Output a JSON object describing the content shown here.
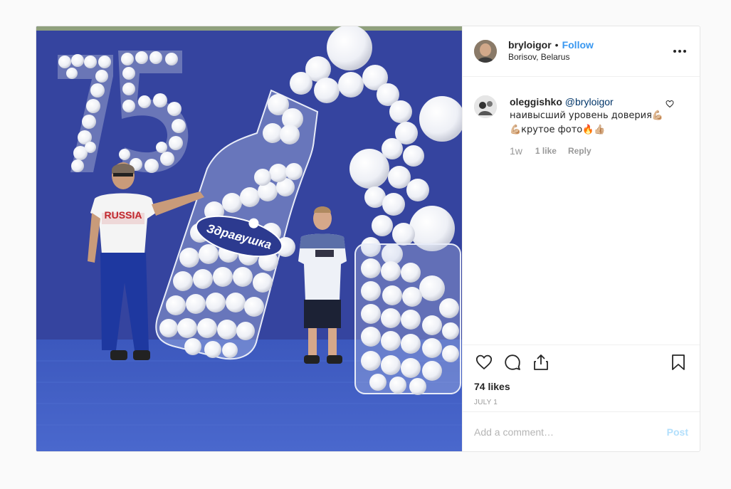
{
  "post": {
    "image_alt": "Photo of a man and a boy beside a balloon-filled bottle with the brand logo in front of a blue backdrop",
    "photo_sign_text": "Здравушка",
    "photo_number": "75",
    "author": {
      "username": "bryloigor",
      "follow_label": "Follow",
      "separator": "•",
      "location": "Borisov, Belarus"
    },
    "comments": [
      {
        "username": "oleggishko",
        "mention": "@bryloigor",
        "text": "наивысший уровень доверия💪🏼💪🏼крутое фото🔥👍🏼",
        "time": "1w",
        "likes": "1 like",
        "reply_label": "Reply"
      }
    ],
    "likes": "74 likes",
    "date": "JULY 1",
    "add_comment": {
      "placeholder": "Add a comment…",
      "post_label": "Post"
    }
  },
  "colors": {
    "link": "#3897f0",
    "mention": "#003569",
    "post_disabled": "#b2dffc",
    "backdrop": "#3c4da8"
  },
  "icons": [
    "more-options-icon",
    "heart-icon",
    "comment-icon",
    "share-icon",
    "bookmark-icon"
  ]
}
